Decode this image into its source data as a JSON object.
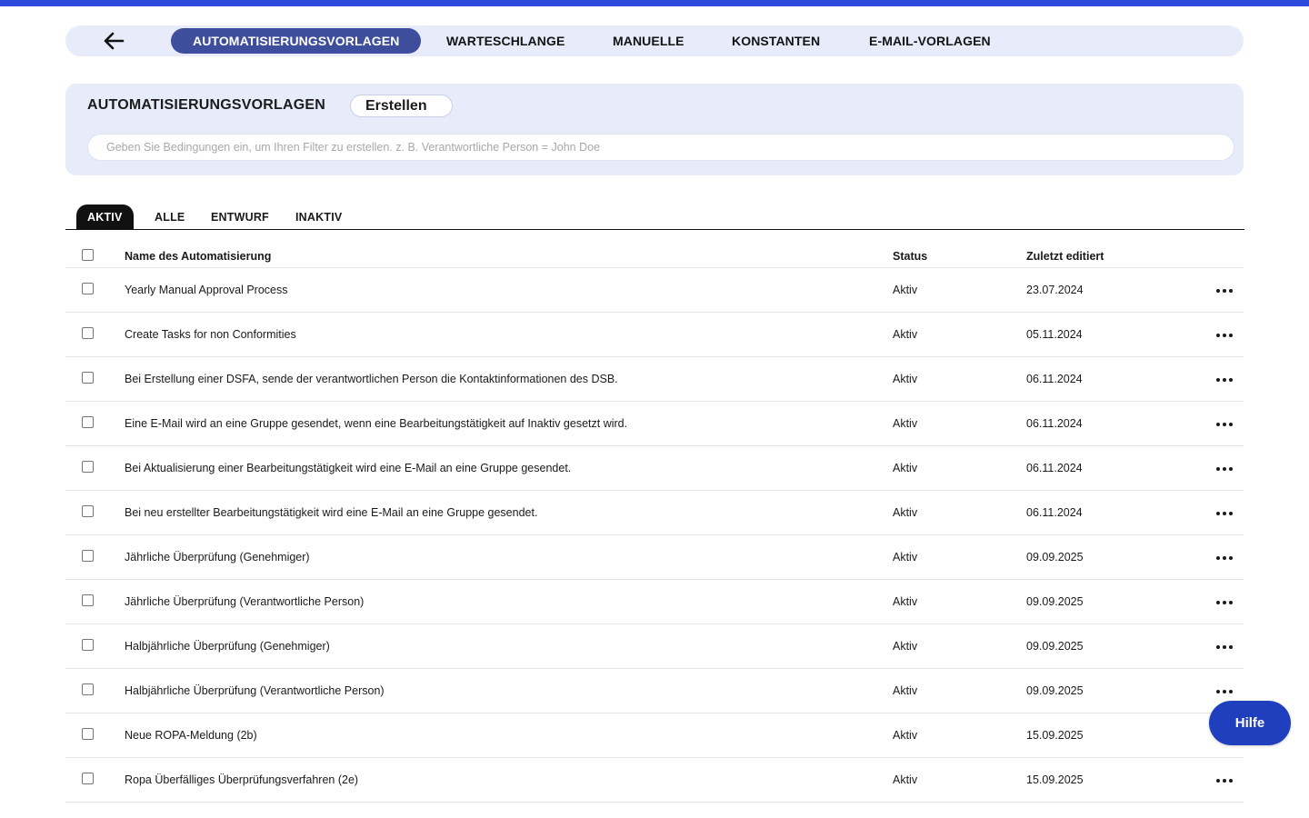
{
  "nav": {
    "tabs": [
      {
        "label": "AUTOMATISIERUNGSVORLAGEN",
        "active": true
      },
      {
        "label": "WARTESCHLANGE",
        "active": false
      },
      {
        "label": "MANUELLE",
        "active": false
      },
      {
        "label": "KONSTANTEN",
        "active": false
      },
      {
        "label": "E-MAIL-VORLAGEN",
        "active": false
      }
    ],
    "back_icon": "arrow-left-icon"
  },
  "panel": {
    "title": "AUTOMATISIERUNGSVORLAGEN",
    "create_label": "Erstellen",
    "filter_placeholder": "Geben Sie Bedingungen ein, um Ihren Filter zu erstellen. z. B. Verantwortliche Person = John Doe"
  },
  "status_tabs": [
    {
      "label": "AKTIV",
      "active": true
    },
    {
      "label": "ALLE",
      "active": false
    },
    {
      "label": "ENTWURF",
      "active": false
    },
    {
      "label": "INAKTIV",
      "active": false
    }
  ],
  "table": {
    "headers": {
      "name": "Name des Automatisierung",
      "status": "Status",
      "edited": "Zuletzt editiert"
    },
    "rows": [
      {
        "name": "Yearly Manual Approval Process",
        "status": "Aktiv",
        "edited": "23.07.2024"
      },
      {
        "name": "Create Tasks for non Conformities",
        "status": "Aktiv",
        "edited": "05.11.2024"
      },
      {
        "name": "Bei Erstellung einer DSFA, sende der verantwortlichen Person die Kontaktinformationen des DSB.",
        "status": "Aktiv",
        "edited": "06.11.2024"
      },
      {
        "name": "Eine E-Mail wird an eine Gruppe gesendet, wenn eine Bearbeitungstätigkeit auf Inaktiv gesetzt wird.",
        "status": "Aktiv",
        "edited": "06.11.2024"
      },
      {
        "name": "Bei Aktualisierung einer Bearbeitungstätigkeit wird eine E-Mail an eine Gruppe gesendet.",
        "status": "Aktiv",
        "edited": "06.11.2024"
      },
      {
        "name": "Bei neu erstellter Bearbeitungstätigkeit wird eine E-Mail an eine Gruppe gesendet.",
        "status": "Aktiv",
        "edited": "06.11.2024"
      },
      {
        "name": "Jährliche Überprüfung (Genehmiger)",
        "status": "Aktiv",
        "edited": "09.09.2025"
      },
      {
        "name": "Jährliche Überprüfung (Verantwortliche Person)",
        "status": "Aktiv",
        "edited": "09.09.2025"
      },
      {
        "name": "Halbjährliche Überprüfung (Genehmiger)",
        "status": "Aktiv",
        "edited": "09.09.2025"
      },
      {
        "name": "Halbjährliche Überprüfung (Verantwortliche Person)",
        "status": "Aktiv",
        "edited": "09.09.2025"
      },
      {
        "name": "Neue ROPA-Meldung (2b)",
        "status": "Aktiv",
        "edited": "15.09.2025"
      },
      {
        "name": "Ropa Überfälliges Überprüfungsverfahren (2e)",
        "status": "Aktiv",
        "edited": "15.09.2025"
      }
    ]
  },
  "help_label": "Hilfe",
  "colors": {
    "accent": "#2f49dc",
    "active_tab": "#3e4e9c",
    "panel_bg": "#e7ebfa",
    "help_button": "#1f3fbf"
  }
}
